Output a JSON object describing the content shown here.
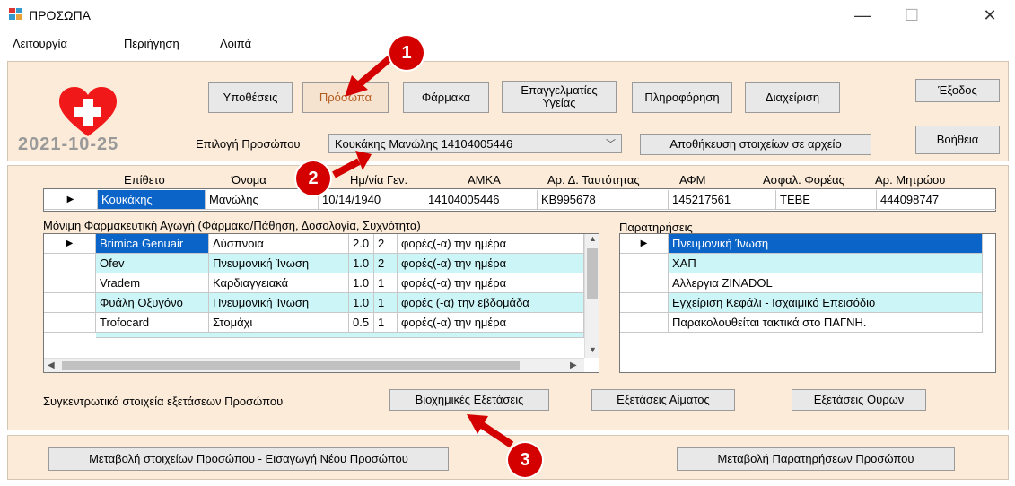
{
  "window": {
    "title": "ΠΡΟΣΩΠΑ",
    "minimize": "—",
    "maximize": "☐",
    "close": "✕"
  },
  "menu": [
    "Λειτουργία",
    "Περιήγηση",
    "Λοιπά"
  ],
  "nav": {
    "hypotheseis": "Υποθέσεις",
    "prosopa": "Πρόσωπα",
    "farmaka": "Φάρμακα",
    "epaggelmaties_line1": "Επαγγελματίες",
    "epaggelmaties_line2": "Υγείας",
    "pliroforisi": "Πληροφόρηση",
    "diaxeirisi": "Διαχείριση",
    "exodos": "Έξοδος",
    "voitheia": "Βοήθεια"
  },
  "date": "2021-10-25",
  "person_select": {
    "label": "Επιλογή Προσώπου",
    "value": "Κουκάκης Μανώλης 14104005446"
  },
  "save_button": "Αποθήκευση στοιχείων σε αρχείο",
  "person_table": {
    "headers": [
      "Επίθετο",
      "Όνομα",
      "Ημ/νία Γεν.",
      "ΑΜΚΑ",
      "Αρ. Δ. Ταυτότητας",
      "ΑΦΜ",
      "Ασφαλ. Φορέας",
      "Αρ. Μητρώου"
    ],
    "row": [
      "Κουκάκης",
      "Μανώλης",
      "10/14/1940",
      "14104005446",
      "ΚΒ995678",
      "145217561",
      "ΤΕΒΕ",
      "444098747"
    ]
  },
  "medication": {
    "title": "Μόνιμη Φαρμακευτική Αγωγή (Φάρμακο/Πάθηση, Δοσολογία, Συχνότητα)",
    "rows": [
      [
        "Brimica Genuair",
        "Δύσπνοια",
        "2.0",
        "2",
        "φορές(-α) την ημέρα"
      ],
      [
        "Ofev",
        "Πνευμονική Ίνωση",
        "1.0",
        "2",
        "φορές(-α) την ημέρα"
      ],
      [
        "Vradem",
        "Καρδιαγγειακά",
        "1.0",
        "1",
        "φορές(-α) την ημέρα"
      ],
      [
        "Φυάλη Οξυγόνο",
        "Πνευμονική Ίνωση",
        "1.0",
        "1",
        "φορές (-α) την εβδομάδα"
      ],
      [
        "Trofocard",
        "Στομάχι",
        "0.5",
        "1",
        "φορές(-α) την ημέρα"
      ]
    ]
  },
  "notes": {
    "title": "Παρατηρήσεις",
    "rows": [
      "Πνευμονική Ίνωση",
      "ΧΑΠ",
      "Αλλεργια ZINADOL",
      "Εγχείριση Κεφάλι - Ισχαιμικό Επεισόδιο",
      "Παρακολουθείται τακτικά στο ΠΑΓΝΗ."
    ]
  },
  "exams": {
    "label": "Συγκεντρωτικά στοιχεία εξετάσεων Προσώπου",
    "biochem": "Βιοχημικές Εξετάσεις",
    "blood": "Εξετάσεις Αίματος",
    "urine": "Εξετάσεις Ούρων"
  },
  "bottom": {
    "edit_person": "Μεταβολή στοιχείων Προσώπου - Εισαγωγή Νέου Προσώπου",
    "edit_notes": "Μεταβολή Παρατηρήσεων Προσώπου"
  },
  "markers": [
    "1",
    "2",
    "3"
  ],
  "colors": {
    "panel": "#fbebd8",
    "selected": "#0b64c7",
    "alt_row": "#ccf5f7",
    "marker": "#d40000"
  }
}
